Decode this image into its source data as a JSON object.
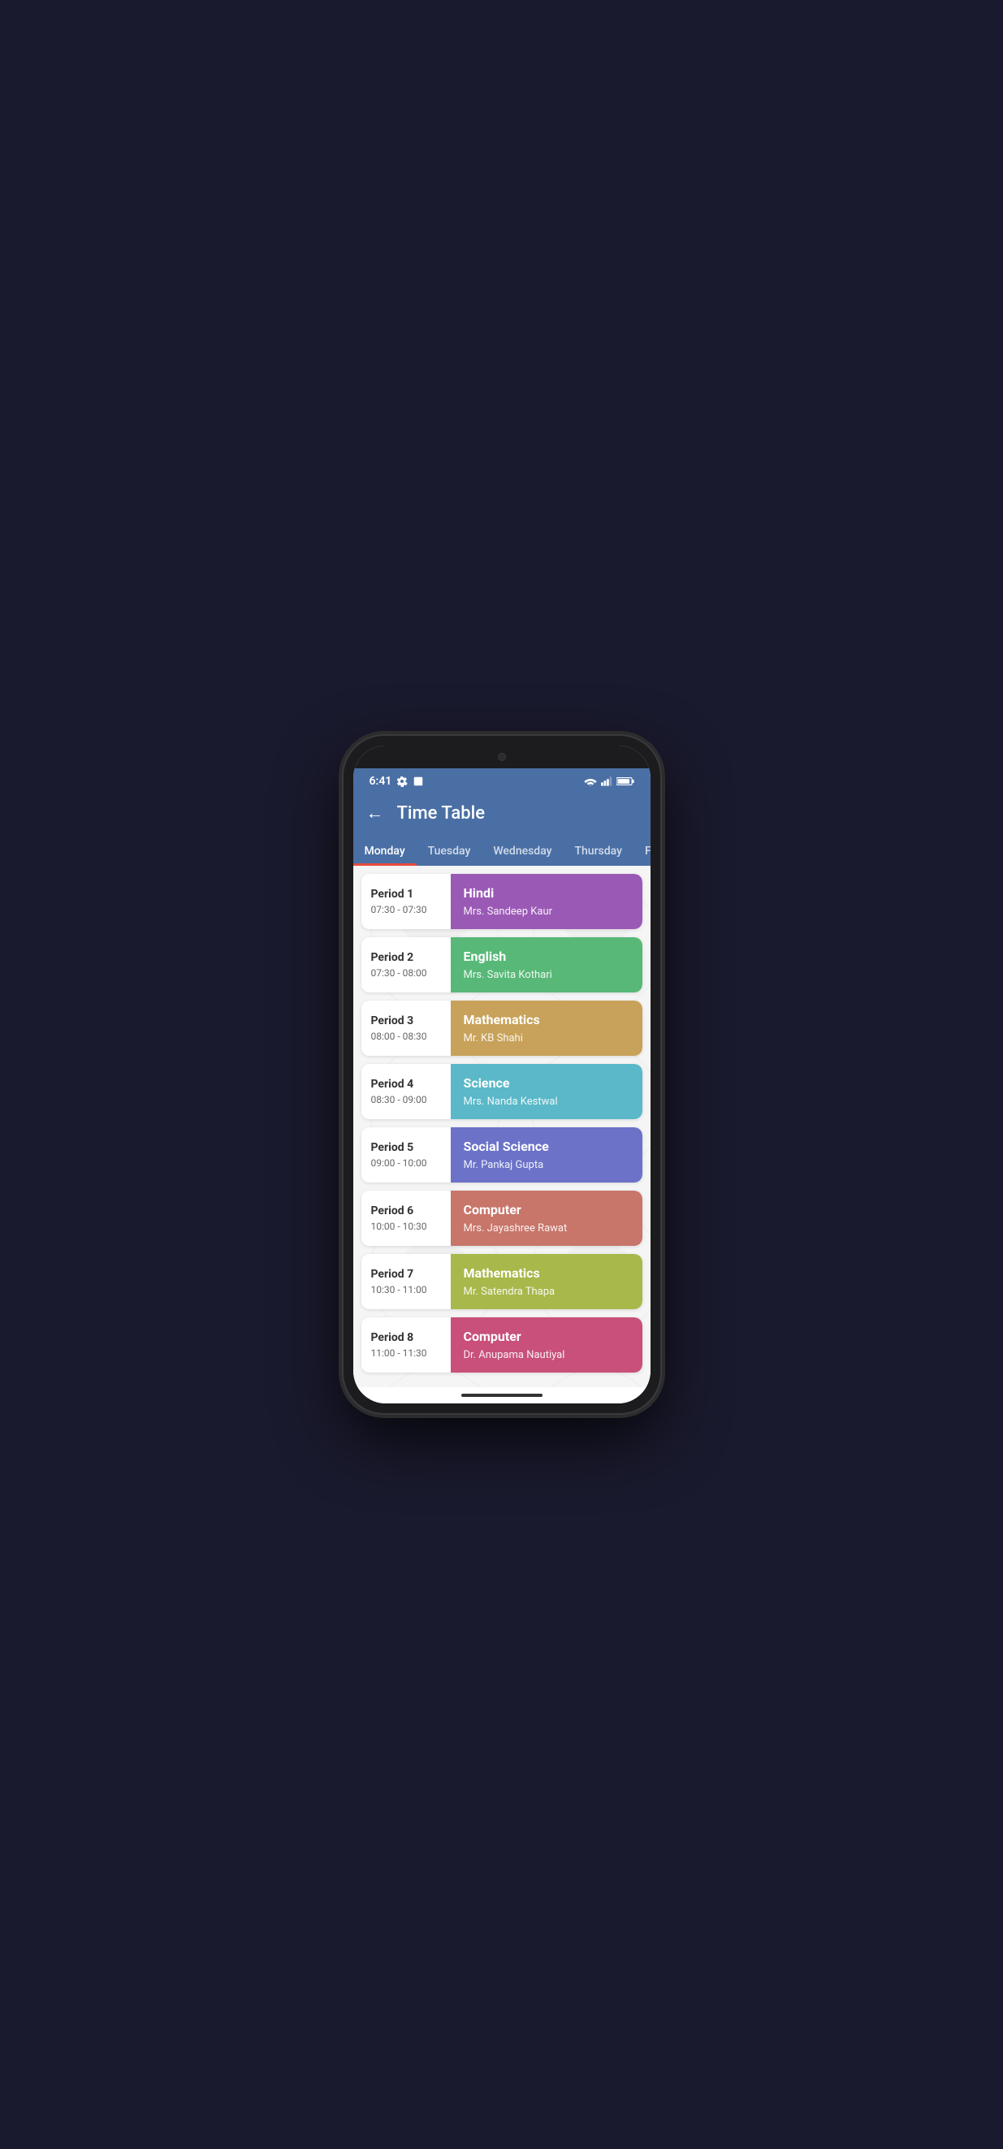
{
  "statusBar": {
    "time": "6:41",
    "settingsIcon": "gear",
    "squareIcon": "square"
  },
  "appBar": {
    "backIcon": "arrow-left",
    "title": "Time Table"
  },
  "tabs": [
    {
      "id": "monday",
      "label": "Monday",
      "active": true
    },
    {
      "id": "tuesday",
      "label": "Tuesday",
      "active": false
    },
    {
      "id": "wednesday",
      "label": "Wednesday",
      "active": false
    },
    {
      "id": "thursday",
      "label": "Thursday",
      "active": false
    },
    {
      "id": "friday",
      "label": "Fr",
      "active": false,
      "partial": true
    }
  ],
  "periods": [
    {
      "id": 1,
      "label": "Period 1",
      "time": "07:30 - 07:30",
      "subject": "Hindi",
      "teacher": "Mrs. Sandeep Kaur",
      "colorClass": "color-purple"
    },
    {
      "id": 2,
      "label": "Period 2",
      "time": "07:30 - 08:00",
      "subject": "English",
      "teacher": "Mrs. Savita Kothari",
      "colorClass": "color-green"
    },
    {
      "id": 3,
      "label": "Period 3",
      "time": "08:00 - 08:30",
      "subject": "Mathematics",
      "teacher": "Mr. KB Shahi",
      "colorClass": "color-tan"
    },
    {
      "id": 4,
      "label": "Period 4",
      "time": "08:30 - 09:00",
      "subject": "Science",
      "teacher": "Mrs. Nanda Kestwal",
      "colorClass": "color-teal"
    },
    {
      "id": 5,
      "label": "Period 5",
      "time": "09:00 - 10:00",
      "subject": "Social Science",
      "teacher": "Mr. Pankaj Gupta",
      "colorClass": "color-indigo"
    },
    {
      "id": 6,
      "label": "Period 6",
      "time": "10:00 - 10:30",
      "subject": "Computer",
      "teacher": "Mrs. Jayashree Rawat",
      "colorClass": "color-salmon"
    },
    {
      "id": 7,
      "label": "Period 7",
      "time": "10:30 - 11:00",
      "subject": "Mathematics",
      "teacher": "Mr. Satendra Thapa",
      "colorClass": "color-olive"
    },
    {
      "id": 8,
      "label": "Period 8",
      "time": "11:00 - 11:30",
      "subject": "Computer",
      "teacher": "Dr. Anupama Nautiyal",
      "colorClass": "color-pink"
    }
  ]
}
